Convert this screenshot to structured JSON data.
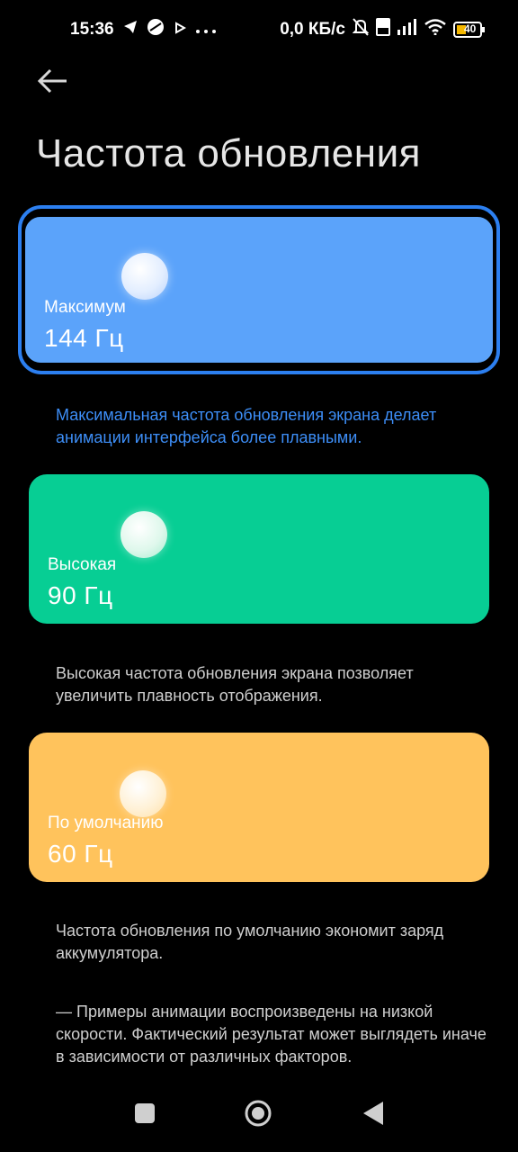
{
  "status_bar": {
    "time": "15:36",
    "left_icons": [
      "telegram-icon",
      "app-icon",
      "play-icon",
      "more-dots-icon"
    ],
    "network_speed": "0,0 КБ/с",
    "right_icons": [
      "mute-icon",
      "volte-icon",
      "signal-icon",
      "wifi-icon",
      "battery-icon"
    ],
    "battery_level": "40"
  },
  "header": {
    "title": "Частота обновления"
  },
  "options": [
    {
      "label": "Максимум",
      "value": "144 Гц",
      "description": "Максимальная частота обновления экрана делает анимации интерфейса более плавными.",
      "color": "#5ba3fa",
      "selected": true
    },
    {
      "label": "Высокая",
      "value": "90 Гц",
      "description": "Высокая частота обновления экрана позволяет увеличить плавность отображения.",
      "color": "#07ce94",
      "selected": false
    },
    {
      "label": "По умолчанию",
      "value": "60 Гц",
      "description": "Частота обновления по умолчанию экономит заряд аккумулятора.",
      "color": "#ffc35c",
      "selected": false
    }
  ],
  "footnote": "— Примеры анимации воспроизведены на низкой скорости. Фактический результат может выглядеть иначе в зависимости от различных факторов.",
  "colors": {
    "accent": "#2c7ff0",
    "selected_description": "#3d8ef7",
    "description": "#cfcfcf",
    "background": "#000000"
  },
  "navigation": {
    "buttons": [
      "recents-button",
      "home-button",
      "back-button"
    ]
  }
}
